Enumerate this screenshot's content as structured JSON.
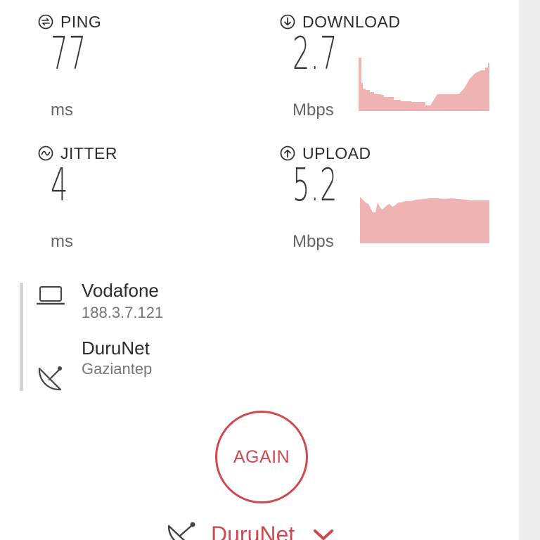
{
  "metrics": {
    "ping": {
      "label": "PING",
      "value": "77",
      "unit": "ms",
      "icon": "ping-icon"
    },
    "download": {
      "label": "DOWNLOAD",
      "value": "2.7",
      "unit": "Mbps",
      "icon": "download-arrow-icon"
    },
    "jitter": {
      "label": "JITTER",
      "value": "4",
      "unit": "ms",
      "icon": "jitter-icon"
    },
    "upload": {
      "label": "UPLOAD",
      "value": "5.2",
      "unit": "Mbps",
      "icon": "upload-arrow-icon"
    }
  },
  "connection": {
    "provider": "Vodafone",
    "ip": "188.3.7.121",
    "server_name": "DuruNet",
    "server_location": "Gaziantep"
  },
  "again_label": "AGAIN",
  "server_select": {
    "name": "DuruNet"
  },
  "colors": {
    "accent": "#cf4a50",
    "graph_fill": "#efb3b3",
    "background": "#ededed"
  }
}
